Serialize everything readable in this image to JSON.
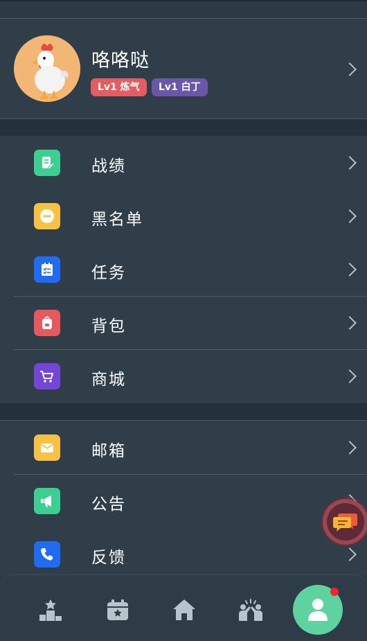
{
  "profile": {
    "username": "咯咯哒",
    "badges": [
      "Lv1 炼气",
      "Lv1 白丁"
    ]
  },
  "menu_group1": [
    {
      "label": "战绩",
      "icon": "record-icon",
      "color": "#3ccf91"
    },
    {
      "label": "黑名单",
      "icon": "blacklist-icon",
      "color": "#f7c244"
    },
    {
      "label": "任务",
      "icon": "task-icon",
      "color": "#1f6cf2"
    },
    {
      "label": "背包",
      "icon": "backpack-icon",
      "color": "#e8585f"
    },
    {
      "label": "商城",
      "icon": "cart-icon",
      "color": "#7446d8"
    }
  ],
  "menu_group2": [
    {
      "label": "邮箱",
      "icon": "mail-icon",
      "color": "#f7c244"
    },
    {
      "label": "公告",
      "icon": "megaphone-icon",
      "color": "#3ccf91"
    },
    {
      "label": "反馈",
      "icon": "phone-icon",
      "color": "#1f6cf2"
    }
  ],
  "tabbar": [
    "ranking-icon",
    "calendar-icon",
    "home-icon",
    "community-icon",
    "profile-icon"
  ],
  "colors": {
    "accent": "#5ed3a0",
    "background": "#2b3a43",
    "notify": "#ff1f2f"
  }
}
